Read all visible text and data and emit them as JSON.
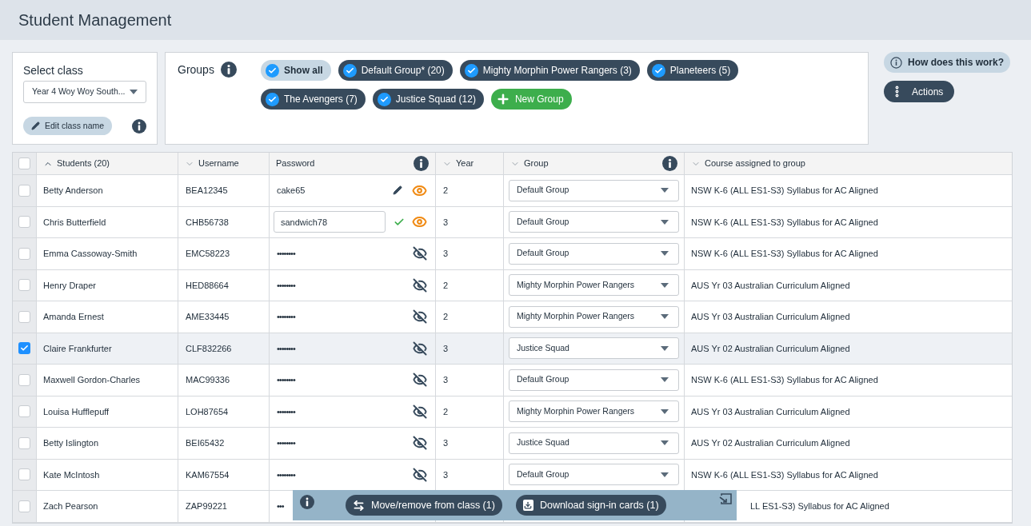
{
  "header": {
    "title": "Student Management"
  },
  "class_panel": {
    "label": "Select class",
    "class_select": "Year 4 Woy Woy South...",
    "edit_button": "Edit class name"
  },
  "groups_panel": {
    "label": "Groups",
    "chips": [
      {
        "kind": "all",
        "label": "Show all",
        "selected": true
      },
      {
        "kind": "group",
        "label": "Default Group* (20)",
        "selected": true
      },
      {
        "kind": "group",
        "label": "Mighty Morphin Power Rangers (3)",
        "selected": true
      },
      {
        "kind": "group",
        "label": "Planeteers (5)",
        "selected": true
      },
      {
        "kind": "group",
        "label": "The Avengers (7)",
        "selected": true
      },
      {
        "kind": "group",
        "label": "Justice Squad (12)",
        "selected": true
      },
      {
        "kind": "new",
        "label": "New Group"
      }
    ]
  },
  "side_buttons": {
    "help": "How does this work?",
    "actions": "Actions"
  },
  "table": {
    "all_selected": false,
    "columns": [
      {
        "kind": "sorted",
        "label": "Students (20)",
        "info": false
      },
      {
        "kind": "sortable",
        "label": "Username",
        "info": false
      },
      {
        "kind": "plain",
        "label": "Password",
        "info": true
      },
      {
        "kind": "sortable",
        "label": "Year",
        "info": false
      },
      {
        "kind": "sortable",
        "label": "Group",
        "info": true
      },
      {
        "kind": "sortable",
        "label": "Course assigned to group",
        "info": false
      }
    ],
    "rows": [
      {
        "selected": false,
        "name": "Betty Anderson",
        "username": "BEA12345",
        "kind": "shown",
        "password": "cake65",
        "year": "2",
        "group": "Default Group",
        "course": "NSW K-6 (ALL ES1-S3) Syllabus for AC Aligned"
      },
      {
        "selected": false,
        "name": "Chris Butterfield",
        "username": "CHB56738",
        "kind": "editing",
        "password": "sandwich78",
        "year": "3",
        "group": "Default Group",
        "course": "NSW K-6 (ALL ES1-S3) Syllabus for AC Aligned"
      },
      {
        "selected": false,
        "name": "Emma Cassoway-Smith",
        "username": "EMC58223",
        "kind": "hidden",
        "password": "••••••••",
        "year": "3",
        "group": "Default Group",
        "course": "NSW K-6 (ALL ES1-S3) Syllabus for AC Aligned"
      },
      {
        "selected": false,
        "name": "Henry Draper",
        "username": "HED88664",
        "kind": "hidden",
        "password": "••••••••",
        "year": "2",
        "group": "Mighty Morphin Power Rangers",
        "course": "AUS Yr 03 Australian Curriculum Aligned"
      },
      {
        "selected": false,
        "name": "Amanda Ernest",
        "username": "AME33445",
        "kind": "hidden",
        "password": "••••••••",
        "year": "2",
        "group": "Mighty Morphin Power Rangers",
        "course": "AUS Yr 03 Australian Curriculum Aligned"
      },
      {
        "selected": true,
        "name": "Claire Frankfurter",
        "username": "CLF832266",
        "kind": "hidden",
        "password": "••••••••",
        "year": "3",
        "group": "Justice Squad",
        "course": "AUS Yr 02 Australian Curriculum Aligned"
      },
      {
        "selected": false,
        "name": "Maxwell Gordon-Charles",
        "username": "MAC99336",
        "kind": "hidden",
        "password": "••••••••",
        "year": "3",
        "group": "Default Group",
        "course": "NSW K-6 (ALL ES1-S3) Syllabus for AC Aligned"
      },
      {
        "selected": false,
        "name": "Louisa Hufflepuff",
        "username": "LOH87654",
        "kind": "hidden",
        "password": "••••••••",
        "year": "2",
        "group": "Mighty Morphin Power Rangers",
        "course": "AUS Yr 03 Australian Curriculum Aligned"
      },
      {
        "selected": false,
        "name": "Betty Islington",
        "username": "BEI65432",
        "kind": "hidden",
        "password": "••••••••",
        "year": "3",
        "group": "Justice Squad",
        "course": "AUS Yr 02 Australian Curriculum Aligned"
      },
      {
        "selected": false,
        "name": "Kate McIntosh",
        "username": "KAM67554",
        "kind": "hidden",
        "password": "••••••••",
        "year": "3",
        "group": "Default Group",
        "course": "NSW K-6 (ALL ES1-S3) Syllabus for AC Aligned"
      },
      {
        "selected": false,
        "name": "Zach Pearson",
        "username": "ZAP99221",
        "kind": "covered",
        "password": "•••",
        "course": "LL ES1-S3) Syllabus for AC Aligned"
      }
    ]
  },
  "action_bar": {
    "move_button": "Move/remove from class (1)",
    "download_button": "Download sign-in cards (1)"
  }
}
